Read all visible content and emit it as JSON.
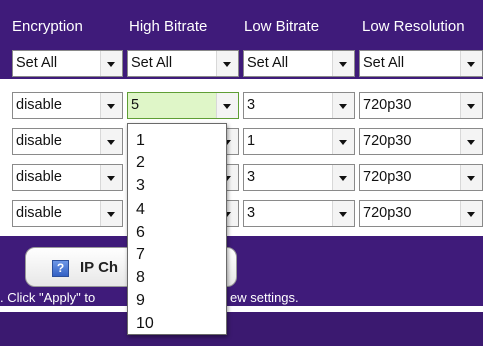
{
  "headers": [
    "Encryption",
    "High Bitrate",
    "Low Bitrate",
    "Low Resolution"
  ],
  "set_all_label": "Set All",
  "rows": [
    {
      "encryption": "disable",
      "high": "5",
      "low": "3",
      "res": "720p30"
    },
    {
      "encryption": "disable",
      "high": "",
      "low": "1",
      "res": "720p30"
    },
    {
      "encryption": "disable",
      "high": "",
      "low": "3",
      "res": "720p30"
    },
    {
      "encryption": "disable",
      "high": "",
      "low": "3",
      "res": "720p30"
    }
  ],
  "dropdown_options": [
    "1",
    "2",
    "3",
    "4",
    "6",
    "7",
    "8",
    "9",
    "10"
  ],
  "button": {
    "icon_glyph": "?",
    "label": "IP Ch"
  },
  "hint_left": ". Click \"Apply\" to",
  "hint_right": "ew settings.",
  "colors": {
    "band": "#3f1b7a",
    "highlight": "#dff6c8"
  }
}
